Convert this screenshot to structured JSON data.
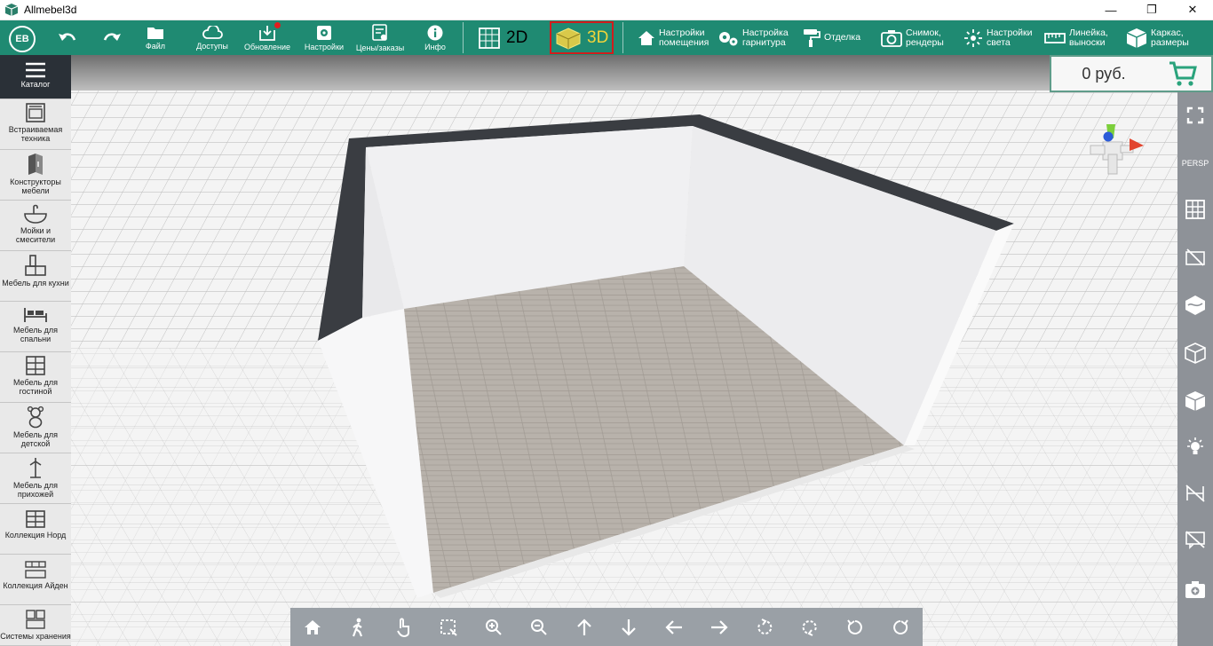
{
  "window": {
    "title": "Allmebel3d",
    "minimize": "—",
    "maximize": "❐",
    "close": "✕"
  },
  "user": {
    "initials": "EB"
  },
  "toolbar": {
    "undo": "undo",
    "redo": "redo",
    "file": "Файл",
    "access": "Доступы",
    "update": "Обновление",
    "settings": "Настройки",
    "prices": "Цены/заказы",
    "info": "Инфо",
    "mode_2d": "2D",
    "mode_3d": "3D",
    "room_settings_1": "Настройки",
    "room_settings_2": "помещения",
    "set_settings_1": "Настройка",
    "set_settings_2": "гарнитура",
    "finishing": "Отделка",
    "snapshot_1": "Снимок,",
    "snapshot_2": "рендеры",
    "light_1": "Настройки",
    "light_2": "света",
    "ruler_1": "Линейка,",
    "ruler_2": "выноски",
    "frame_1": "Каркас,",
    "frame_2": "размеры"
  },
  "cart": {
    "total": "0 руб."
  },
  "sidebar": {
    "items": [
      {
        "label": "Каталог",
        "icon": "menu-icon"
      },
      {
        "label": "Встраиваемая техника",
        "icon": "oven-icon"
      },
      {
        "label": "Конструкторы мебели",
        "icon": "cabinet-constructor-icon"
      },
      {
        "label": "Мойки и смесители",
        "icon": "sink-icon"
      },
      {
        "label": "Мебель для кухни",
        "icon": "kitchen-icon"
      },
      {
        "label": "Мебель для спальни",
        "icon": "bed-icon"
      },
      {
        "label": "Мебель для гостиной",
        "icon": "shelving-icon"
      },
      {
        "label": "Мебель для детской",
        "icon": "teddy-bear-icon"
      },
      {
        "label": "Мебель для прихожей",
        "icon": "coat-hanger-icon"
      },
      {
        "label": "Коллекция Норд",
        "icon": "dresser-icon"
      },
      {
        "label": "Коллекция Айден",
        "icon": "rack-icon"
      },
      {
        "label": "Системы хранения",
        "icon": "storage-icon"
      }
    ]
  },
  "rightbar": {
    "persp": "PERSP"
  },
  "colors": {
    "accent": "#1f8a72",
    "mode_3d_text": "#f0d43a",
    "mode_3d_border": "#d21c1c",
    "sidebar_dark": "#2a3037",
    "tool_gray": "#8e9298"
  }
}
